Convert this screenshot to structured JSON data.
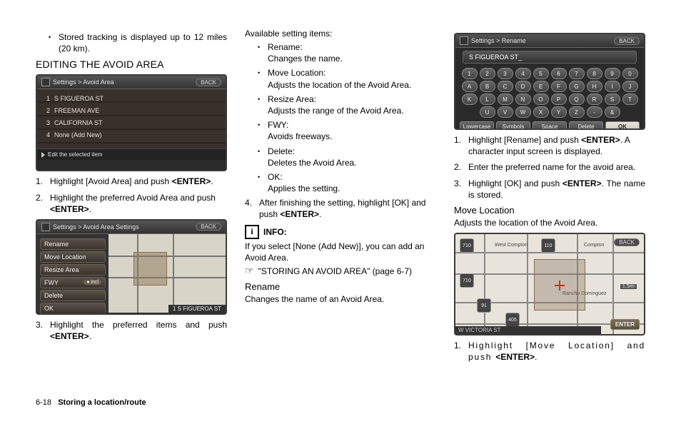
{
  "col1": {
    "bullet_intro": "Stored tracking is displayed up to 12 miles (20 km).",
    "heading": "EDITING THE AVOID AREA",
    "ss1": {
      "title": "Settings > Avoid Area",
      "back": "BACK",
      "rows": [
        {
          "n": "1",
          "t": "S FIGUEROA ST"
        },
        {
          "n": "2",
          "t": "FREEMAN AVE"
        },
        {
          "n": "3",
          "t": "CALIFORNIA ST"
        },
        {
          "n": "4",
          "t": "None (Add New)"
        }
      ],
      "footer": "Edit the selected item"
    },
    "step1": "Highlight [Avoid Area] and push ",
    "enter": "<ENTER>",
    "step2": "Highlight the preferred Avoid Area and push ",
    "ss2": {
      "title": "Settings > Avoid Area Settings",
      "back": "BACK",
      "opts": [
        "Rename",
        "Move Location",
        "Resize Area"
      ],
      "fwy": "FWY",
      "fwy_pill": "● incl",
      "opts2": [
        "Delete",
        "OK"
      ],
      "map_footer": "1   S FIGUEROA ST"
    },
    "step3": "Highlight the preferred items and push "
  },
  "col2": {
    "avail": "Available setting items:",
    "items": [
      {
        "t": "Rename:",
        "d": "Changes the name."
      },
      {
        "t": "Move Location:",
        "d": "Adjusts the location of the Avoid Area."
      },
      {
        "t": "Resize Area:",
        "d": "Adjusts the range of the Avoid Area."
      },
      {
        "t": "FWY:",
        "d": "Avoids freeways."
      },
      {
        "t": "Delete:",
        "d": "Deletes the Avoid Area."
      },
      {
        "t": "OK:",
        "d": "Applies the setting."
      }
    ],
    "step4": "After finishing the setting, highlight [OK] and push ",
    "info_label": "INFO:",
    "info_text": "If you select [None (Add New)], you can add an Avoid Area.",
    "ref": "\"STORING AN AVOID AREA\" (page 6-7)",
    "rename_h": "Rename",
    "rename_t": "Changes the name of an Avoid Area."
  },
  "col3": {
    "ss3": {
      "title": "Settings > Rename",
      "back": "BACK",
      "input": "S FIGUEROA ST_",
      "row1": [
        "1",
        "2",
        "3",
        "4",
        "5",
        "6",
        "7",
        "8",
        "9",
        "0"
      ],
      "row2": [
        "A",
        "B",
        "C",
        "D",
        "E",
        "F",
        "G",
        "H",
        "I",
        "J"
      ],
      "row3": [
        "K",
        "L",
        "M",
        "N",
        "O",
        "P",
        "Q",
        "R",
        "S",
        "T"
      ],
      "row4": [
        "U",
        "V",
        "W",
        "X",
        "Y",
        "Z",
        "-",
        "&"
      ],
      "btns": [
        "Lowercase",
        "Symbols",
        "Space",
        "Delete"
      ],
      "ok": "OK"
    },
    "step1": "Highlight [Rename] and push ",
    "step1b": ". A character input screen is displayed.",
    "step2": "Enter the preferred name for the avoid area.",
    "step3": "Highlight [OK] and push ",
    "step3b": ". The name is stored.",
    "move_h": "Move Location",
    "move_t": "Adjusts the location of the Avoid Area.",
    "ss4": {
      "back": "BACK",
      "shields": [
        "710",
        "110",
        "91",
        "405",
        "710",
        "710",
        "110"
      ],
      "labels": [
        "West Compton",
        "Compton",
        "Rancho Dominguez",
        "1.5mi"
      ],
      "enter": "ENTER",
      "footer": "W VICTORIA ST"
    },
    "mstep1": "Highlight [Move Location] and push "
  },
  "footer": {
    "page": "6-18",
    "section": "Storing a location/route"
  },
  "enter": "<ENTER>"
}
